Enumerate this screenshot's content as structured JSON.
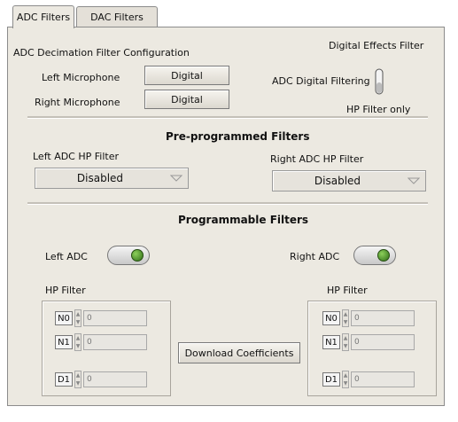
{
  "tabs": [
    {
      "label": "ADC Filters",
      "active": true
    },
    {
      "label": "DAC Filters",
      "active": false
    }
  ],
  "decimation": {
    "title": "ADC Decimation Filter Configuration",
    "left_label": "Left Microphone",
    "left_value": "Digital",
    "right_label": "Right Microphone",
    "right_value": "Digital"
  },
  "effects": {
    "title": "Digital Effects Filter",
    "switch_label": "ADC Digital Filtering",
    "switch_state_label": "HP Filter only"
  },
  "preprogrammed": {
    "title": "Pre-programmed Filters",
    "left_label": "Left ADC HP Filter",
    "left_value": "Disabled",
    "right_label": "Right ADC HP Filter",
    "right_value": "Disabled"
  },
  "programmable": {
    "title": "Programmable Filters",
    "left_label": "Left ADC",
    "right_label": "Right ADC",
    "left_group": "HP Filter",
    "right_group": "HP Filter",
    "coefficients": [
      "N0",
      "N1",
      "D1"
    ],
    "coef_value": "0",
    "download_label": "Download Coefficients"
  },
  "colors": {
    "panel": "#ece9e1",
    "toggle_led": "#4a9a22"
  }
}
